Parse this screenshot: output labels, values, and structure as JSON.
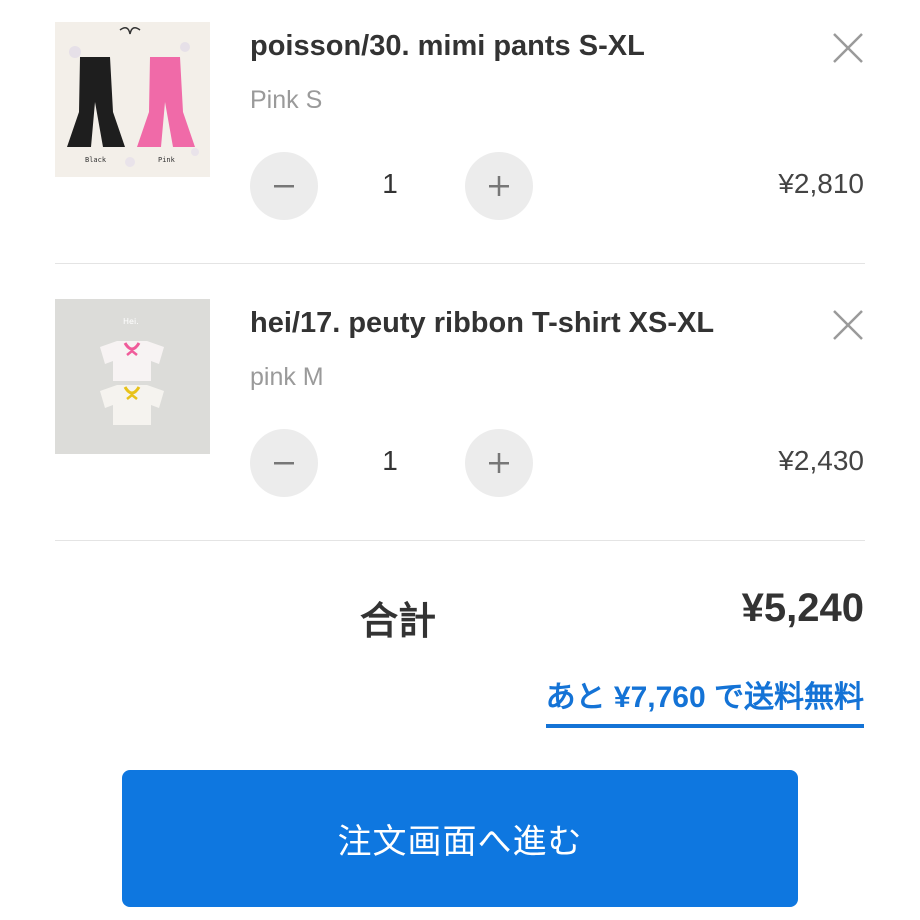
{
  "cart": {
    "items": [
      {
        "title": "poisson/30. mimi pants S-XL",
        "variant": "Pink S",
        "quantity": "1",
        "price": "¥2,810",
        "thumbnail_labels": [
          "Black",
          "Pink"
        ]
      },
      {
        "title": "hei/17. peuty ribbon T-shirt XS-XL",
        "variant": "pink M",
        "quantity": "1",
        "price": "¥2,430",
        "thumbnail_labels": [
          "Hei."
        ]
      }
    ],
    "total_label": "合計",
    "total_value": "¥5,240",
    "shipping_notice": "あと ¥7,760 で送料無料",
    "checkout_label": "注文画面へ進む"
  },
  "colors": {
    "accent": "#1473d6",
    "button": "#0e77e0",
    "qty_button_bg": "#ececec",
    "muted_text": "#9a9a9a"
  },
  "icons": [
    "minus-icon",
    "plus-icon",
    "close-icon"
  ]
}
